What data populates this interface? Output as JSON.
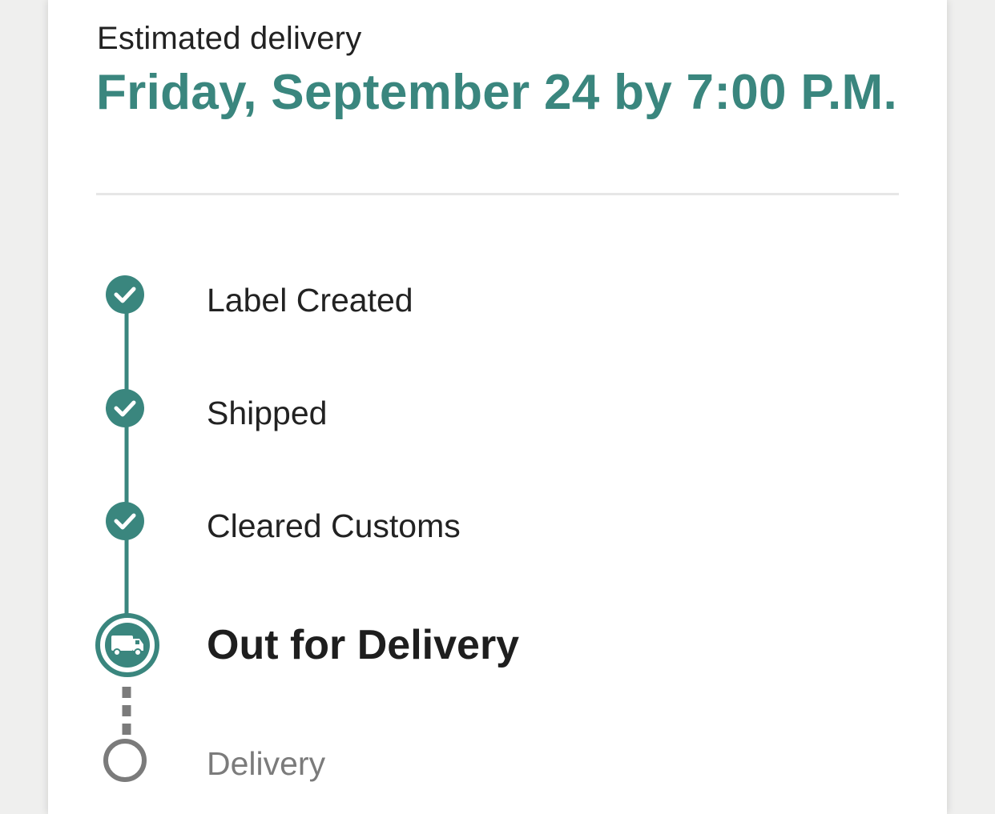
{
  "delivery": {
    "label": "Estimated delivery",
    "date": "Friday, September 24 by 7:00 P.M."
  },
  "steps": [
    {
      "label": "Label Created",
      "status": "complete",
      "icon": "check-icon"
    },
    {
      "label": "Shipped",
      "status": "complete",
      "icon": "check-icon"
    },
    {
      "label": "Cleared Customs",
      "status": "complete",
      "icon": "check-icon"
    },
    {
      "label": "Out for Delivery",
      "status": "current",
      "icon": "truck-icon"
    },
    {
      "label": "Delivery",
      "status": "pending",
      "icon": "empty-circle-icon"
    }
  ],
  "colors": {
    "accent": "#3a867e",
    "pending": "#7b7b7b",
    "text": "#222222"
  }
}
